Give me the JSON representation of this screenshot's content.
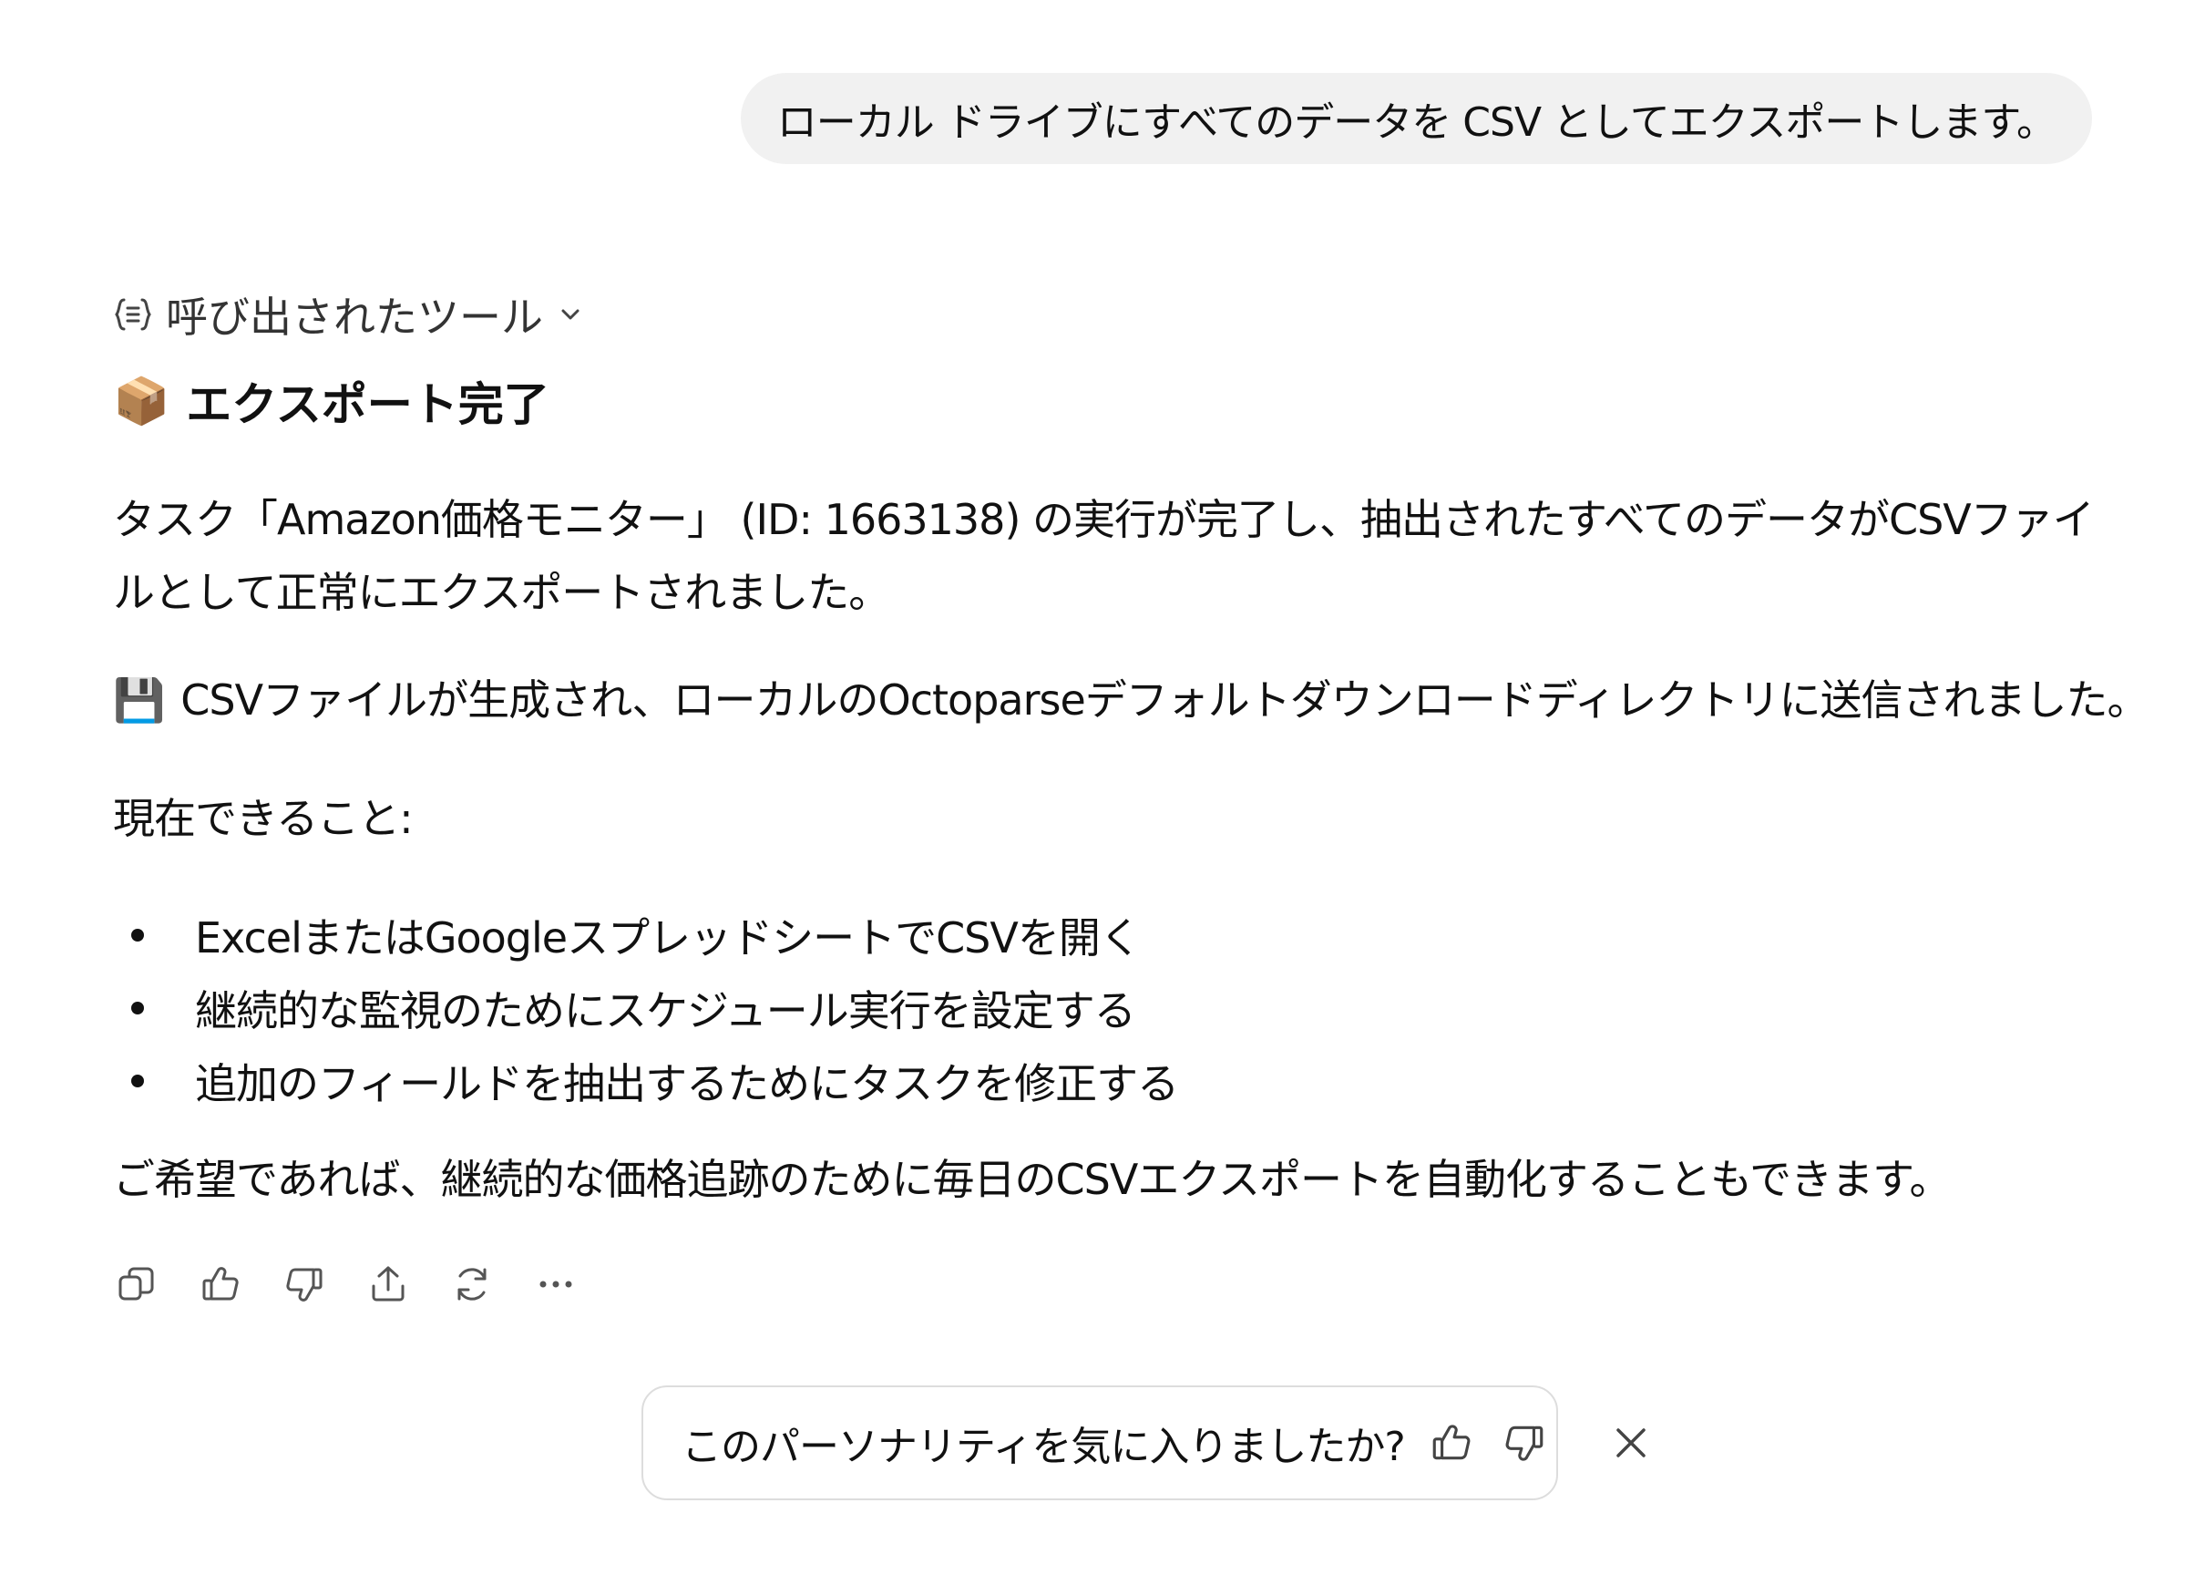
{
  "user_message": "ローカル ドライブにすべてのデータを CSV としてエクスポートします。",
  "tools_toggle": {
    "label": "呼び出されたツール",
    "icon": "braces-list-icon",
    "chevron": "chevron-down-icon"
  },
  "response": {
    "heading_emoji": "📦",
    "heading": "エクスポート完了",
    "para1": "タスク「Amazon価格モニター」 (ID: 1663138) の実行が完了し、抽出されたすべてのデータがCSVファイルとして正常にエクスポートされました。",
    "para2_emoji": "💾",
    "para2": "CSVファイルが生成され、ローカルのOctoparseデフォルトダウンロードディレクトリに送信されました。",
    "para3": "現在できること:",
    "bullets": [
      "ExcelまたはGoogleスプレッドシートでCSVを開く",
      "継続的な監視のためにスケジュール実行を設定する",
      "追加のフィールドを抽出するためにタスクを修正する"
    ],
    "para4": "ご希望であれば、継続的な価格追跡のために毎日のCSVエクスポートを自動化することもできます。"
  },
  "actions": [
    "copy-icon",
    "thumbs-up-icon",
    "thumbs-down-icon",
    "share-icon",
    "regenerate-icon",
    "more-icon"
  ],
  "feedback": {
    "question": "このパーソナリティを気に入りましたか?",
    "icons": [
      "thumbs-up-icon",
      "thumbs-down-icon",
      "close-icon"
    ]
  },
  "colors": {
    "bubble_bg": "#f1f1f1",
    "text": "#111111",
    "icon": "#555555",
    "border": "#dddddd"
  }
}
